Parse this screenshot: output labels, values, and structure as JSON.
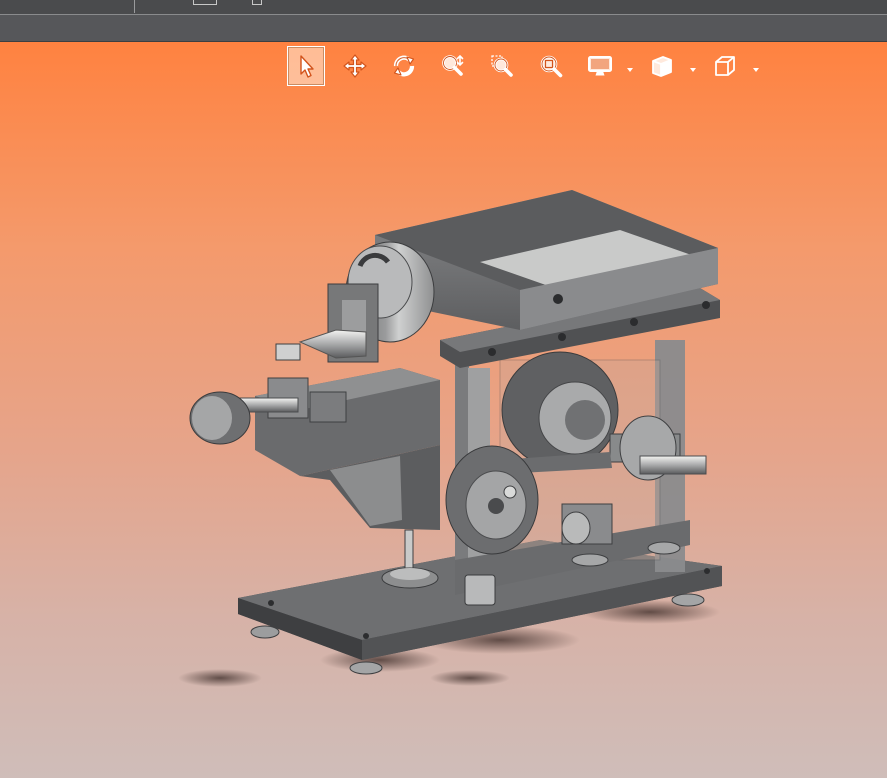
{
  "window": {
    "title": ""
  },
  "colors": {
    "viewport_top": "#ff8240",
    "viewport_bottom": "#cfbdb9",
    "chrome_dark": "#4a4b4d",
    "icon_fill": "#ffffff",
    "icon_stroke": "#e05a22"
  },
  "heads_up_toolbar": {
    "tools": [
      {
        "icon": "select-pointer-icon",
        "active": true
      },
      {
        "icon": "pan-move-icon",
        "active": false
      },
      {
        "icon": "rotate-view-icon",
        "active": false
      },
      {
        "icon": "zoom-in-out-icon",
        "active": false
      },
      {
        "icon": "zoom-to-area-icon",
        "active": false
      },
      {
        "icon": "zoom-to-fit-icon",
        "active": false
      },
      {
        "icon": "display-style-icon",
        "active": false,
        "has_dropdown": true
      },
      {
        "icon": "view-orientation-icon",
        "active": false,
        "has_dropdown": true
      },
      {
        "icon": "section-view-cube-icon",
        "active": false,
        "has_dropdown": true
      }
    ]
  },
  "model": {
    "description_icon": "cad-assembly-machine"
  }
}
